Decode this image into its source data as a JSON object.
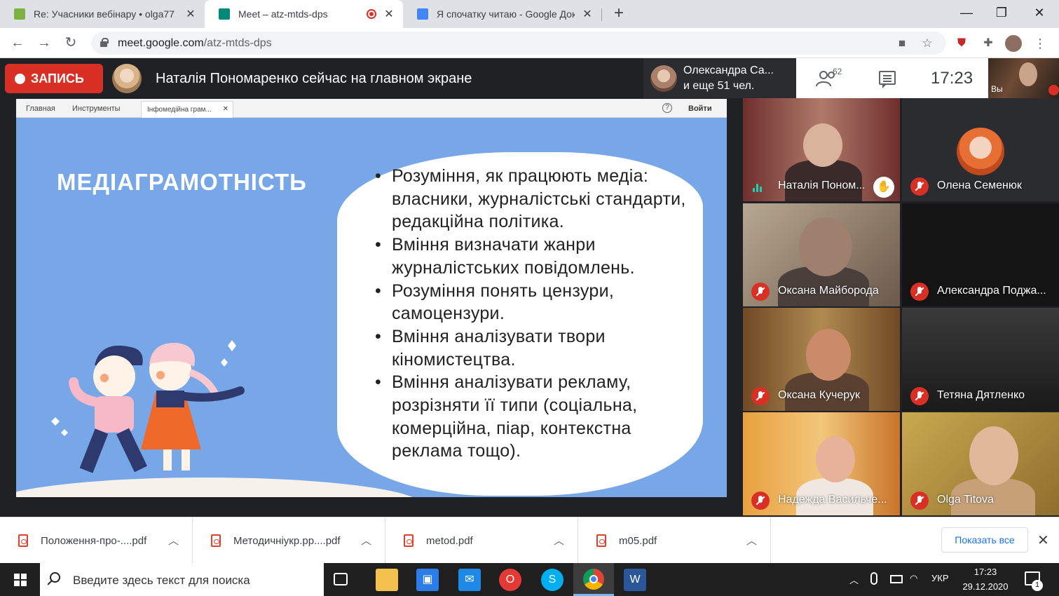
{
  "browser": {
    "tabs": [
      {
        "title": "Re: Учасники вебінару • olga77",
        "favicon_color": "#7cb342"
      },
      {
        "title": "Meet – atz-mtds-dps",
        "favicon_color": "#00897b"
      },
      {
        "title": "Я спочатку читаю - Google Доку",
        "favicon_color": "#4285f4"
      }
    ],
    "url_host": "meet.google.com",
    "url_path": "/atz-mtds-dps"
  },
  "meet": {
    "record_label": "ЗАПИСЬ",
    "presenting_text": "Наталія Пономаренко сейчас на главном экране",
    "people_line1": "Олександра Са...",
    "people_line2": "и еще 51 чел.",
    "participant_count": "62",
    "time": "17:23",
    "self_label": "Вы"
  },
  "presentation": {
    "menu": [
      "Главная",
      "Инструменты"
    ],
    "doc_tab": "Інфомедійна грам...",
    "login": "Войти",
    "title": "МЕДІАГРАМОТНІСТЬ",
    "bullets": [
      "Розуміння, як працюють медіа: власники, журналістські стандарти, редакційна політика.",
      "Вміння визначати жанри журналістських повідомлень.",
      "Розуміння понять цензури, самоцензури.",
      "Вміння аналізувати твори кіномистецтва.",
      "Вміння аналізувати рекламу, розрізняти її типи (соціальна, комерційна, піар, контекстна реклама тощо)."
    ]
  },
  "participants": [
    {
      "name": "Наталія Поном...",
      "bg": "#7a3f3a"
    },
    {
      "name": "Олена Семенюк",
      "bg": "#2b2c2f"
    },
    {
      "name": "Оксана Майборода",
      "bg": "#8b7a6a"
    },
    {
      "name": "Александра Поджа...",
      "bg": "#1a1a1a"
    },
    {
      "name": "Оксана Кучерук",
      "bg": "#8c6a3c"
    },
    {
      "name": "Тетяна Дятленко",
      "bg": "#2a2a2a"
    },
    {
      "name": "Надежда Васильче...",
      "bg": "#d88a2f"
    },
    {
      "name": "Olga Titova",
      "bg": "#b0903e"
    }
  ],
  "downloads": {
    "files": [
      "Положення-про-....pdf",
      "Методичніукр.рр....pdf",
      "metod.pdf",
      "m05.pdf"
    ],
    "show_all": "Показать все"
  },
  "taskbar": {
    "search_placeholder": "Введите здесь текст для поиска",
    "lang": "УКР",
    "time": "17:23",
    "date": "29.12.2020",
    "notifications": "1"
  }
}
